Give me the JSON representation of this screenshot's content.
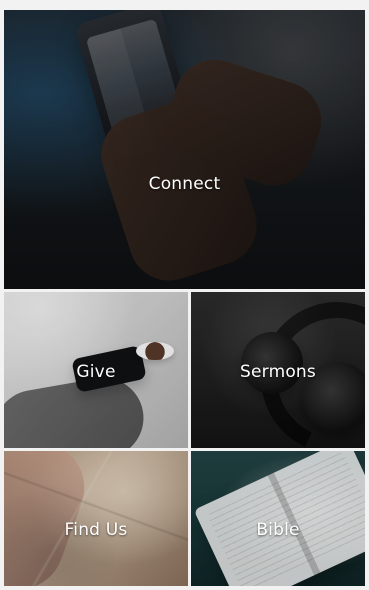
{
  "tiles": {
    "connect": {
      "label": "Connect"
    },
    "give": {
      "label": "Give"
    },
    "sermons": {
      "label": "Sermons"
    },
    "find_us": {
      "label": "Find Us"
    },
    "bible": {
      "label": "Bible"
    }
  }
}
